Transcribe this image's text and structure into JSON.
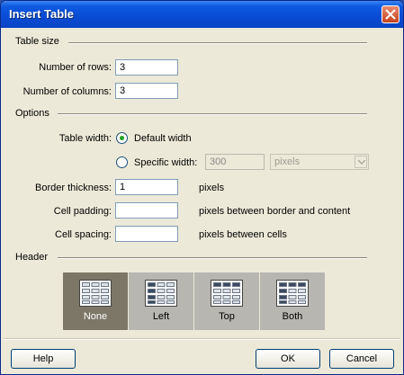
{
  "window": {
    "title": "Insert Table",
    "close_icon": "close-icon"
  },
  "table_size": {
    "heading": "Table size",
    "rows_label": "Number of rows:",
    "rows_value": "3",
    "columns_label": "Number of columns:",
    "columns_value": "3"
  },
  "options": {
    "heading": "Options",
    "table_width_label": "Table width:",
    "default_width_label": "Default width",
    "specific_width_label": "Specific width:",
    "specific_width_value": "300",
    "unit_select_value": "pixels",
    "selected_width_mode": "default",
    "border_label": "Border thickness:",
    "border_value": "1",
    "border_unit": "pixels",
    "padding_label": "Cell padding:",
    "padding_value": "",
    "padding_hint": "pixels between border and content",
    "spacing_label": "Cell spacing:",
    "spacing_value": "",
    "spacing_hint": "pixels between cells"
  },
  "header": {
    "heading": "Header",
    "choices": [
      {
        "label": "None",
        "icon": "header-none-icon",
        "selected": true
      },
      {
        "label": "Left",
        "icon": "header-left-icon",
        "selected": false
      },
      {
        "label": "Top",
        "icon": "header-top-icon",
        "selected": false
      },
      {
        "label": "Both",
        "icon": "header-both-icon",
        "selected": false
      }
    ]
  },
  "footer": {
    "help_label": "Help",
    "ok_label": "OK",
    "cancel_label": "Cancel"
  },
  "colors": {
    "title_bar": "#0a4bd4",
    "dialog_bg": "#ece9d8",
    "selected_header": "#7c7767"
  }
}
